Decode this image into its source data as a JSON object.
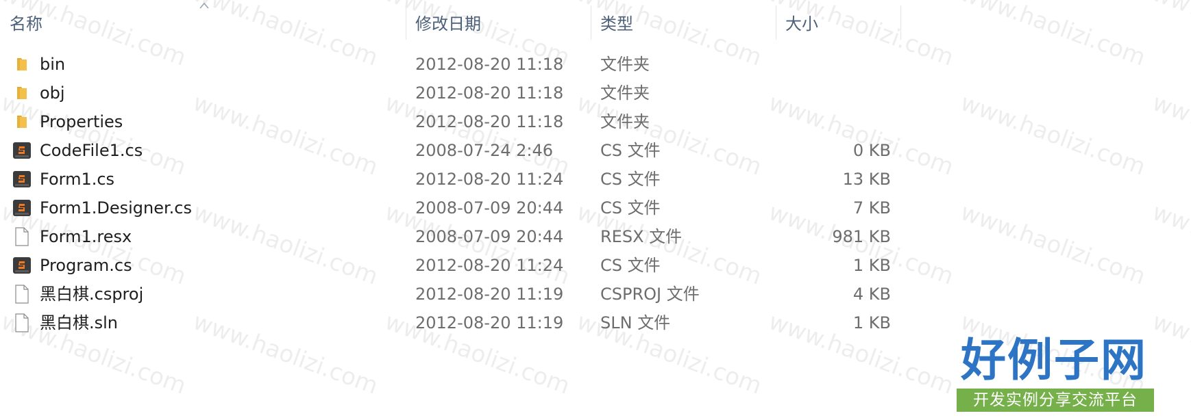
{
  "header": {
    "name_label": "名称",
    "date_label": "修改日期",
    "type_label": "类型",
    "size_label": "大小"
  },
  "files": [
    {
      "icon": "folder-icon",
      "name": "bin",
      "date": "2012-08-20 11:18",
      "type": "文件夹",
      "size": ""
    },
    {
      "icon": "folder-icon",
      "name": "obj",
      "date": "2012-08-20 11:18",
      "type": "文件夹",
      "size": ""
    },
    {
      "icon": "folder-icon",
      "name": "Properties",
      "date": "2012-08-20 11:18",
      "type": "文件夹",
      "size": ""
    },
    {
      "icon": "cs-file-icon",
      "name": "CodeFile1.cs",
      "date": "2008-07-24 2:46",
      "type": "CS 文件",
      "size": "0 KB"
    },
    {
      "icon": "cs-file-icon",
      "name": "Form1.cs",
      "date": "2012-08-20 11:24",
      "type": "CS 文件",
      "size": "13 KB"
    },
    {
      "icon": "cs-file-icon",
      "name": "Form1.Designer.cs",
      "date": "2008-07-09 20:44",
      "type": "CS 文件",
      "size": "7 KB"
    },
    {
      "icon": "blank-file-icon",
      "name": "Form1.resx",
      "date": "2008-07-09 20:44",
      "type": "RESX 文件",
      "size": "981 KB"
    },
    {
      "icon": "cs-file-icon",
      "name": "Program.cs",
      "date": "2012-08-20 11:24",
      "type": "CS 文件",
      "size": "1 KB"
    },
    {
      "icon": "blank-file-icon",
      "name": "黑白棋.csproj",
      "date": "2012-08-20 11:19",
      "type": "CSPROJ 文件",
      "size": "4 KB"
    },
    {
      "icon": "blank-file-icon",
      "name": "黑白棋.sln",
      "date": "2012-08-20 11:19",
      "type": "SLN 文件",
      "size": "1 KB"
    }
  ],
  "watermark": "www.haolizi.com",
  "logo": {
    "title": "好例子网",
    "subtitle": "开发实例分享交流平台"
  },
  "colors": {
    "header_text": "#4c607a",
    "folder": "#f3c14b",
    "cs_icon_bg": "#3b3b3b",
    "cs_icon_accent": "#f07a22",
    "logo_blue": "#2d74c4",
    "logo_green": "#76b04a"
  }
}
